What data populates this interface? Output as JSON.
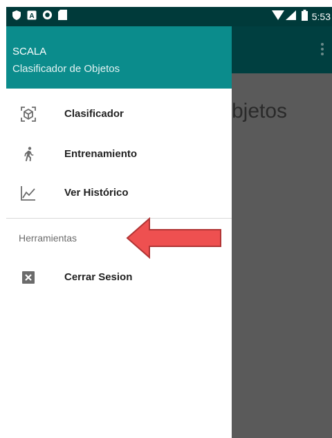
{
  "status_bar": {
    "time": "5:53",
    "left_icons": [
      "shield-icon",
      "keyboard-icon",
      "record-icon",
      "sd-card-icon"
    ],
    "right_icons": [
      "wifi-icon",
      "signal-icon",
      "battery-icon"
    ]
  },
  "drawer": {
    "header": {
      "app_name": "SCALA",
      "subtitle": "Clasificador de Objetos",
      "color": "#0b8c8c"
    },
    "items": [
      {
        "label": "Clasificador",
        "icon": "cube-scan-icon"
      },
      {
        "label": "Entrenamiento",
        "icon": "running-person-icon"
      },
      {
        "label": "Ver Histórico",
        "icon": "line-chart-icon"
      }
    ],
    "section": {
      "label": "Herramientas",
      "items": [
        {
          "label": "Cerrar Sesion",
          "icon": "close-box-icon"
        }
      ]
    }
  },
  "main": {
    "title_partial": "bjetos",
    "toolbar_color": "#003f40"
  },
  "colors": {
    "annotation_arrow": "#ee5050"
  }
}
